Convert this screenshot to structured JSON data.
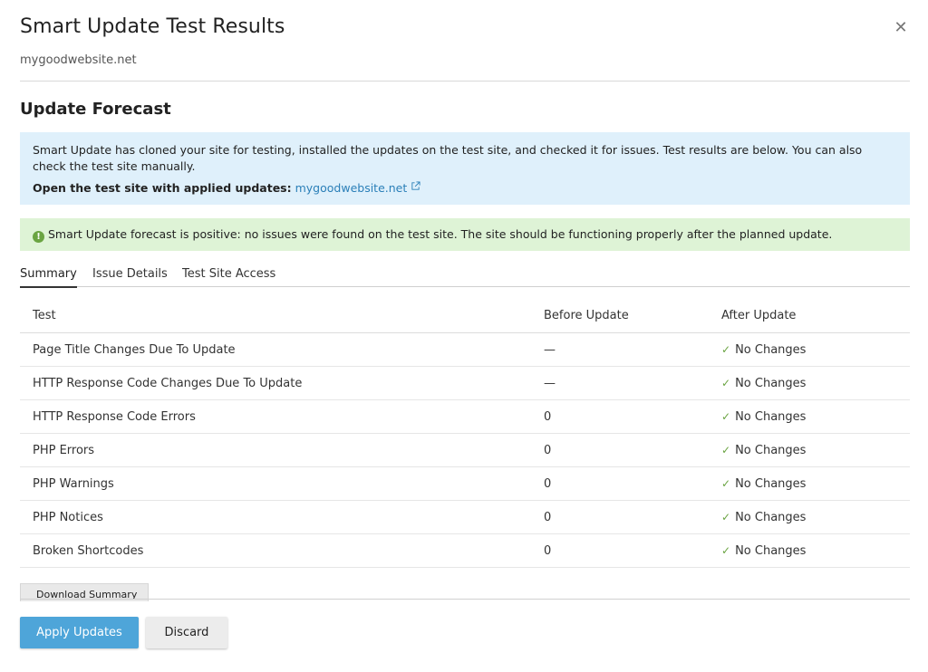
{
  "dialog": {
    "title": "Smart Update Test Results",
    "close_icon": "close-icon",
    "subtitle": "mygoodwebsite.net"
  },
  "forecast": {
    "heading": "Update Forecast",
    "info_text": "Smart Update has cloned your site for testing, installed the updates on the test site, and checked it for issues. Test results are below. You can also check the test site manually.",
    "open_label": "Open the test site with applied updates:",
    "test_site_link": "mygoodwebsite.net",
    "success_text": "Smart Update forecast is positive: no issues were found on the test site. The site should be functioning properly after the planned update."
  },
  "tabs": [
    {
      "label": "Summary",
      "active": true
    },
    {
      "label": "Issue Details",
      "active": false
    },
    {
      "label": "Test Site Access",
      "active": false
    }
  ],
  "table": {
    "columns": [
      "Test",
      "Before Update",
      "After Update"
    ],
    "rows": [
      {
        "test": "Page Title Changes Due To Update",
        "before": "—",
        "after": "No Changes"
      },
      {
        "test": "HTTP Response Code Changes Due To Update",
        "before": "—",
        "after": "No Changes"
      },
      {
        "test": "HTTP Response Code Errors",
        "before": "0",
        "after": "No Changes"
      },
      {
        "test": "PHP Errors",
        "before": "0",
        "after": "No Changes"
      },
      {
        "test": "PHP Warnings",
        "before": "0",
        "after": "No Changes"
      },
      {
        "test": "PHP Notices",
        "before": "0",
        "after": "No Changes"
      },
      {
        "test": "Broken Shortcodes",
        "before": "0",
        "after": "No Changes"
      }
    ]
  },
  "download_label": "Download Summary",
  "footer": {
    "apply_label": "Apply Updates",
    "discard_label": "Discard"
  },
  "colors": {
    "accent": "#4ea5d9",
    "info_bg": "#dff0fb",
    "success_bg": "#def3d6",
    "success_icon": "#6aa442",
    "link": "#2a7fb8"
  }
}
